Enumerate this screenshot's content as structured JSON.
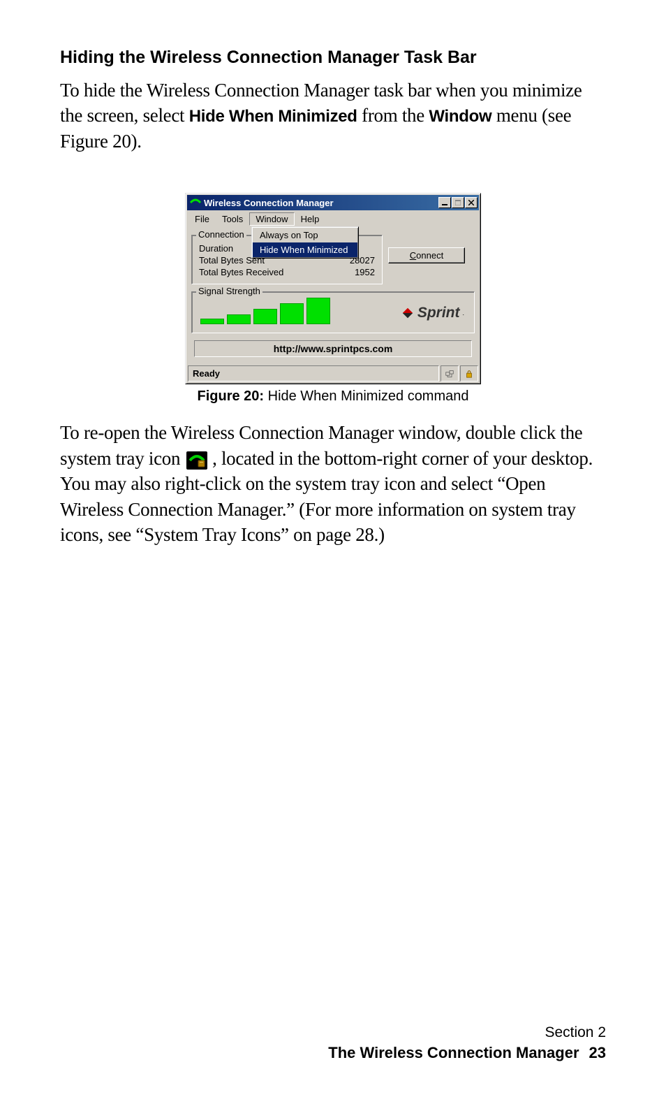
{
  "heading": "Hiding the Wireless Connection Manager Task Bar",
  "para1": {
    "pre": "To hide the Wireless Connection Manager task bar when you minimize the screen, select ",
    "bold1": "Hide When Minimized",
    "mid": " from the ",
    "bold2": "Window",
    "post": " menu (see Figure 20)."
  },
  "window": {
    "title": "Wireless Connection Manager",
    "menus": {
      "file": "File",
      "tools": "Tools",
      "window": "Window",
      "help": "Help"
    },
    "dropdown": {
      "always_on_top": "Always on Top",
      "hide_when_minimized": "Hide When Minimized"
    },
    "connection": {
      "legend": "Connection",
      "duration_label": "Duration",
      "sent_label": "Total Bytes Sent",
      "sent_value": "28027",
      "recv_label": "Total Bytes Received",
      "recv_value": "1952"
    },
    "connect_button_pre": "C",
    "connect_button_post": "onnect",
    "signal_legend": "Signal Strength",
    "sprint": "Sprint",
    "url": "http://www.sprintpcs.com",
    "status": "Ready"
  },
  "figure_caption": {
    "bold": "Figure 20:",
    "rest": " Hide When Minimized command"
  },
  "para2": {
    "pre": "To re-open the Wireless Connection Manager window, double click the system tray icon ",
    "post": " , located in the bottom-right corner of your desktop. You may also right-click on the system tray icon and select “Open Wireless Connection Manager.” (For more information on system tray icons, see “System Tray Icons” on page 28.)"
  },
  "footer": {
    "section": "Section 2",
    "title": "The Wireless Connection Manager",
    "page": "23"
  }
}
